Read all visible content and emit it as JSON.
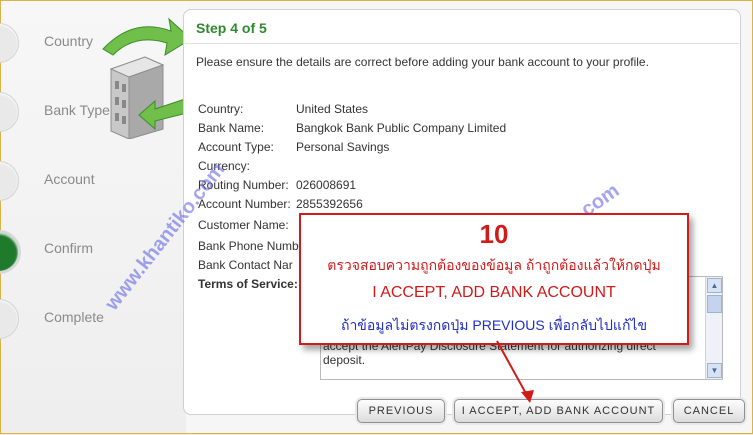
{
  "steps": [
    {
      "label": "Country"
    },
    {
      "label": "Bank Type"
    },
    {
      "label": "Account"
    },
    {
      "label": "Confirm"
    },
    {
      "label": "Complete"
    }
  ],
  "card": {
    "title": "Step 4 of 5",
    "intro": "Please ensure the details are correct before adding your bank account to your profile."
  },
  "details": [
    {
      "label": "Country:",
      "value": "United States"
    },
    {
      "label": "Bank Name:",
      "value": "Bangkok Bank Public Company Limited"
    },
    {
      "label": "Account Type:",
      "value": "Personal Savings"
    },
    {
      "label": "Currency:",
      "value": ""
    },
    {
      "label": "Routing Number:",
      "value": "026008691"
    },
    {
      "label": "Account Number:",
      "value": "2855392656"
    },
    {
      "label": "Customer Name:",
      "value": ""
    },
    {
      "label": "Bank Phone Numb",
      "value": ""
    },
    {
      "label": "Bank Contact Nar",
      "value": ""
    }
  ],
  "terms": {
    "label": "Terms of Service:",
    "text": "accept the AlertPay Disclosure Statement for authorizing direct deposit."
  },
  "buttons": {
    "previous": "PREVIOUS",
    "accept": "I ACCEPT, ADD BANK ACCOUNT",
    "cancel": "CANCEL"
  },
  "callout": {
    "number": "10",
    "line1": "ตรวจสอบความถูกต้องของข้อมูล ถ้าถูกต้องแล้วให้กดปุ่ม",
    "line2": "I ACCEPT, ADD BANK ACCOUNT",
    "line3": "ถ้าข้อมูลไม่ตรงกดปุ่ม PREVIOUS เพื่อกลับไปแก้ไข"
  },
  "watermark": {
    "left": "www.khantiko.com",
    "right": "www.khantiko.com"
  },
  "colors": {
    "title_green": "#2f8a2f",
    "active_step": "#1f7a2c",
    "callout_red": "#d11a1a",
    "callout_blue": "#1f2fc0"
  },
  "icons": [
    "bank-transfer-illustration",
    "scroll-up-icon",
    "scroll-down-icon",
    "callout-arrow"
  ]
}
